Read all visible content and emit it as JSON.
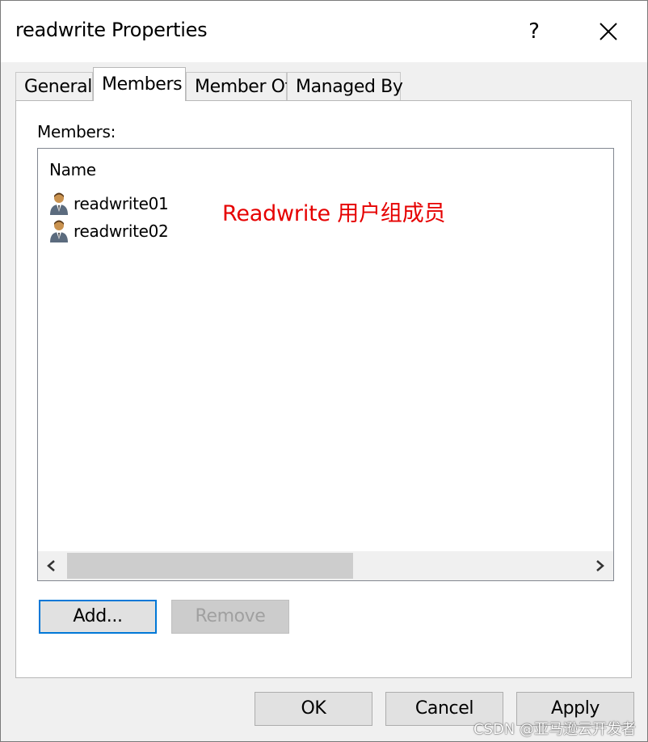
{
  "window": {
    "title": "readwrite Properties",
    "help_label": "?",
    "close_icon": "close-icon"
  },
  "tabs": [
    {
      "label": "General",
      "active": false
    },
    {
      "label": "Members",
      "active": true
    },
    {
      "label": "Member Of",
      "active": false
    },
    {
      "label": "Managed By",
      "active": false
    }
  ],
  "members": {
    "label": "Members:",
    "column_header": "Name",
    "rows": [
      {
        "icon": "user-icon",
        "name": "readwrite01"
      },
      {
        "icon": "user-icon",
        "name": "readwrite02"
      }
    ],
    "annotation": "Readwrite 用户组成员",
    "annotation_color": "#e60000"
  },
  "buttons": {
    "add": "Add...",
    "remove": "Remove",
    "ok": "OK",
    "cancel": "Cancel",
    "apply": "Apply"
  },
  "watermark": "CSDN @亚马逊云开发者",
  "colors": {
    "focus_border": "#0078d7",
    "dialog_bg": "#f0f0f0",
    "disabled_text": "#a0a0a0"
  }
}
